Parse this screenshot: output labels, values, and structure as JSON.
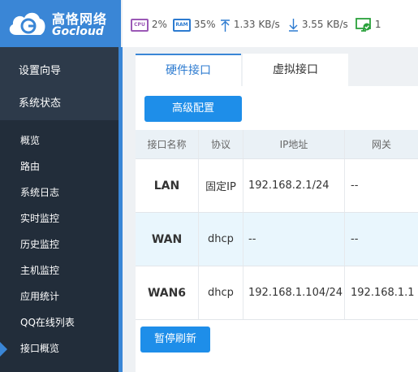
{
  "brand": {
    "name_cn": "高恪网络",
    "name_en": "Gocloud"
  },
  "status": {
    "cpu_label": "CPU",
    "cpu_value": "2%",
    "ram_label": "RAM",
    "ram_value": "35%",
    "upload": "1.33 KB/s",
    "download": "3.55 KB/s",
    "online_count": "1"
  },
  "sidebar": {
    "top_items": [
      {
        "label": "设置向导"
      },
      {
        "label": "系统状态"
      }
    ],
    "sub_items": [
      {
        "label": "概览"
      },
      {
        "label": "路由"
      },
      {
        "label": "系统日志"
      },
      {
        "label": "实时监控"
      },
      {
        "label": "历史监控"
      },
      {
        "label": "主机监控"
      },
      {
        "label": "应用统计"
      },
      {
        "label": "QQ在线列表"
      },
      {
        "label": "接口概览"
      }
    ]
  },
  "tabs": [
    {
      "label": "硬件接口"
    },
    {
      "label": "虚拟接口"
    }
  ],
  "toolbar": {
    "advanced_label": "高级配置",
    "pause_label": "暂停刷新"
  },
  "table": {
    "headers": [
      "接口名称",
      "协议",
      "IP地址",
      "网关"
    ],
    "rows": [
      {
        "name": "LAN",
        "protocol": "固定IP",
        "ip": "192.168.2.1/24",
        "gateway": "--"
      },
      {
        "name": "WAN",
        "protocol": "dhcp",
        "ip": "--",
        "gateway": "--"
      },
      {
        "name": "WAN6",
        "protocol": "dhcp",
        "ip": "192.168.1.104/24",
        "gateway": "192.168.1.1"
      }
    ]
  },
  "colors": {
    "brand_blue": "#3a86d6",
    "button_blue": "#1e8ee9",
    "sidebar_bg": "#2d3a4a"
  },
  "icons": [
    "cpu-icon",
    "ram-icon",
    "upload-arrow-icon",
    "download-arrow-icon",
    "online-monitor-icon",
    "cloud-logo-icon"
  ]
}
